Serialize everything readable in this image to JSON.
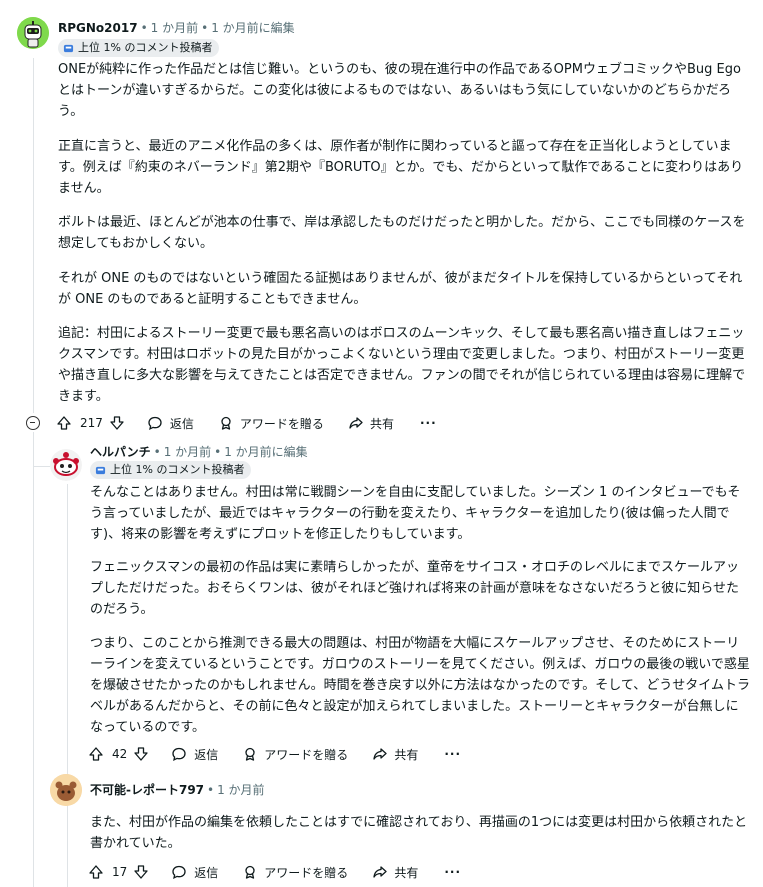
{
  "comments": [
    {
      "author": "RPGNo2017",
      "time": "1 か月前",
      "edited": "1 か月前に編集",
      "badge": "上位 1% のコメント投稿者",
      "paragraphs": [
        "ONEが純粋に作った作品だとは信じ難い。というのも、彼の現在進行中の作品であるOPMウェブコミックやBug Egoとはトーンが違いすぎるからだ。この変化は彼によるものではない、あるいはもう気にしていないかのどちらかだろう。",
        "正直に言うと、最近のアニメ化作品の多くは、原作者が制作に関わっていると謳って存在を正当化しようとしています。例えば『約束のネバーランド』第2期や『BORUTO』とか。でも、だからといって駄作であることに変わりはありません。",
        "ボルトは最近、ほとんどが池本の仕事で、岸は承認したものだけだったと明かした。だから、ここでも同様のケースを想定してもおかしくない。",
        "それが ONE のものではないという確固たる証拠はありませんが、彼がまだタイトルを保持しているからといってそれが ONE のものであると証明することもできません。",
        "追記：村田によるストーリー変更で最も悪名高いのはボロスのムーンキック、そして最も悪名高い描き直しはフェニックスマンです。村田はロボットの見た目がかっこよくないという理由で変更しました。つまり、村田がストーリー変更や描き直しに多大な影響を与えてきたことは否定できません。ファンの間でそれが信じられている理由は容易に理解できます。"
      ],
      "votes": "217",
      "reply": "返信",
      "award": "アワードを贈る",
      "share": "共有",
      "more": "···"
    },
    {
      "author": "ヘルパンチ",
      "time": "1 か月前",
      "edited": "1 か月前に編集",
      "badge": "上位 1% のコメント投稿者",
      "paragraphs": [
        "そんなことはありません。村田は常に戦闘シーンを自由に支配していました。シーズン 1 のインタビューでもそう言っていましたが、最近ではキャラクターの行動を変えたり、キャラクターを追加したり(彼は偏った人間です)、将来の影響を考えずにプロットを修正したりもしています。",
        "フェニックスマンの最初の作品は実に素晴らしかったが、童帝をサイコス・オロチのレベルにまでスケールアップしただけだった。おそらくワンは、彼がそれほど強ければ将来の計画が意味をなさないだろうと彼に知らせたのだろう。",
        "つまり、このことから推測できる最大の問題は、村田が物語を大幅にスケールアップさせ、そのためにストーリーラインを変えているということです。ガロウのストーリーを見てください。例えば、ガロウの最後の戦いで惑星を爆破させたかったのかもしれません。時間を巻き戻す以外に方法はなかったのです。そして、どうせタイムトラベルがあるんだからと、その前に色々と設定が加えられてしまいました。ストーリーとキャラクターが台無しになっているのです。"
      ],
      "votes": "42",
      "reply": "返信",
      "award": "アワードを贈る",
      "share": "共有",
      "more": "···"
    },
    {
      "author": "不可能-レポート797",
      "time": "1 か月前",
      "paragraphs": [
        "また、村田が作品の編集を依頼したことはすでに確認されており、再描画の1つには変更は村田から依頼されたと書かれていた。"
      ],
      "votes": "17",
      "reply": "返信",
      "award": "アワードを贈る",
      "share": "共有",
      "more": "···"
    }
  ],
  "colors": {
    "text": "#0f1a1c",
    "meta": "#576f76",
    "line": "#dfe3e6",
    "badge_bg": "#eaedef"
  },
  "icons": [
    "avatar-robot",
    "avatar-snoo-red",
    "avatar-snoo-brown",
    "badge-icon",
    "upvote-icon",
    "downvote-icon",
    "reply-icon",
    "award-icon",
    "share-icon",
    "more-icon",
    "collapse-icon"
  ]
}
